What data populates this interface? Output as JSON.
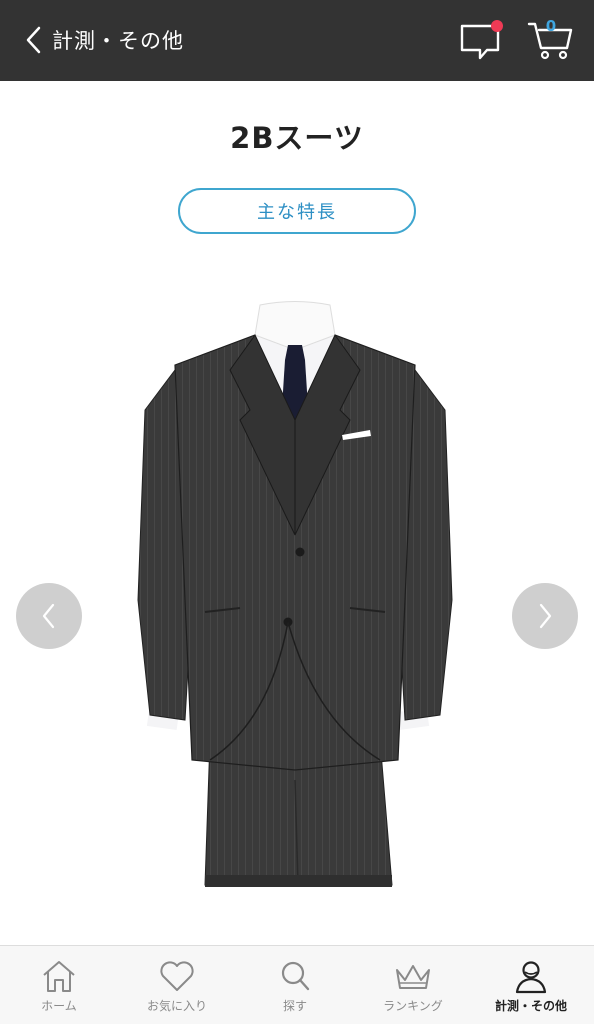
{
  "header": {
    "title": "計測・その他",
    "cart_count": "0",
    "notification_color": "#ef3a55"
  },
  "product": {
    "name": "2Bスーツ",
    "feature_button": "主な特長"
  },
  "tabbar": {
    "active_tab": "measure",
    "tabs": [
      {
        "id": "home",
        "label": "ホーム",
        "icon": "home-icon"
      },
      {
        "id": "favorites",
        "label": "お気に入り",
        "icon": "heart-icon"
      },
      {
        "id": "search",
        "label": "探す",
        "icon": "search-icon"
      },
      {
        "id": "ranking",
        "label": "ランキング",
        "icon": "crown-icon"
      },
      {
        "id": "measure",
        "label": "計測・その他",
        "icon": "person-icon"
      }
    ]
  },
  "colors": {
    "header_bg": "#333333",
    "accent": "#3fa6cf",
    "arrow_bg": "#cfcfcf"
  }
}
